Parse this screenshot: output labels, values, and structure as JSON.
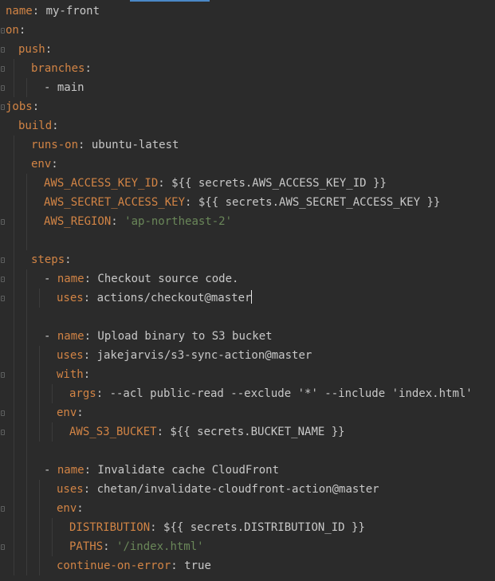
{
  "editor": {
    "lines": [
      {
        "parts": [
          {
            "t": "name",
            "c": "k"
          },
          {
            "t": ": my-front",
            "c": "p"
          }
        ]
      },
      {
        "parts": [
          {
            "t": "on",
            "c": "k"
          },
          {
            "t": ":",
            "c": "p"
          }
        ]
      },
      {
        "parts": [
          {
            "t": "push",
            "c": "k"
          },
          {
            "t": ":",
            "c": "p"
          }
        ]
      },
      {
        "parts": [
          {
            "t": "branches",
            "c": "k"
          },
          {
            "t": ":",
            "c": "p"
          }
        ]
      },
      {
        "parts": [
          {
            "t": "- main",
            "c": "p"
          }
        ]
      },
      {
        "parts": [
          {
            "t": "jobs",
            "c": "k"
          },
          {
            "t": ":",
            "c": "p"
          }
        ]
      },
      {
        "parts": [
          {
            "t": "build",
            "c": "k"
          },
          {
            "t": ":",
            "c": "p"
          }
        ]
      },
      {
        "parts": [
          {
            "t": "runs-on",
            "c": "k"
          },
          {
            "t": ": ubuntu-latest",
            "c": "p"
          }
        ]
      },
      {
        "parts": [
          {
            "t": "env",
            "c": "k"
          },
          {
            "t": ":",
            "c": "p"
          }
        ]
      },
      {
        "parts": [
          {
            "t": "AWS_ACCESS_KEY_ID",
            "c": "k"
          },
          {
            "t": ": ${{ secrets.AWS_ACCESS_KEY_ID }}",
            "c": "p"
          }
        ]
      },
      {
        "parts": [
          {
            "t": "AWS_SECRET_ACCESS_KEY",
            "c": "k"
          },
          {
            "t": ": ${{ secrets.AWS_SECRET_ACCESS_KEY }}",
            "c": "p"
          }
        ]
      },
      {
        "parts": [
          {
            "t": "AWS_REGION",
            "c": "k"
          },
          {
            "t": ": ",
            "c": "p"
          },
          {
            "t": "'ap-northeast-2'",
            "c": "s"
          }
        ]
      },
      {
        "parts": []
      },
      {
        "parts": [
          {
            "t": "steps",
            "c": "k"
          },
          {
            "t": ":",
            "c": "p"
          }
        ]
      },
      {
        "parts": [
          {
            "t": "- ",
            "c": "p"
          },
          {
            "t": "name",
            "c": "k"
          },
          {
            "t": ": Checkout source code.",
            "c": "p"
          }
        ]
      },
      {
        "parts": [
          {
            "t": "uses",
            "c": "k"
          },
          {
            "t": ": actions/checkout@master",
            "c": "p"
          }
        ]
      },
      {
        "parts": []
      },
      {
        "parts": [
          {
            "t": "- ",
            "c": "p"
          },
          {
            "t": "name",
            "c": "k"
          },
          {
            "t": ": Upload binary to S3 bucket",
            "c": "p"
          }
        ]
      },
      {
        "parts": [
          {
            "t": "uses",
            "c": "k"
          },
          {
            "t": ": jakejarvis/s3-sync-action@master",
            "c": "p"
          }
        ]
      },
      {
        "parts": [
          {
            "t": "with",
            "c": "k"
          },
          {
            "t": ":",
            "c": "p"
          }
        ]
      },
      {
        "parts": [
          {
            "t": "args",
            "c": "k"
          },
          {
            "t": ": --acl public-read --exclude '*' --include 'index.html'",
            "c": "p"
          }
        ]
      },
      {
        "parts": [
          {
            "t": "env",
            "c": "k"
          },
          {
            "t": ":",
            "c": "p"
          }
        ]
      },
      {
        "parts": [
          {
            "t": "AWS_S3_BUCKET",
            "c": "k"
          },
          {
            "t": ": ${{ secrets.BUCKET_NAME }}",
            "c": "p"
          }
        ]
      },
      {
        "parts": []
      },
      {
        "parts": [
          {
            "t": "- ",
            "c": "p"
          },
          {
            "t": "name",
            "c": "k"
          },
          {
            "t": ": Invalidate cache CloudFront",
            "c": "p"
          }
        ]
      },
      {
        "parts": [
          {
            "t": "uses",
            "c": "k"
          },
          {
            "t": ": chetan/invalidate-cloudfront-action@master",
            "c": "p"
          }
        ]
      },
      {
        "parts": [
          {
            "t": "env",
            "c": "k"
          },
          {
            "t": ":",
            "c": "p"
          }
        ]
      },
      {
        "parts": [
          {
            "t": "DISTRIBUTION",
            "c": "k"
          },
          {
            "t": ": ${{ secrets.DISTRIBUTION_ID }}",
            "c": "p"
          }
        ]
      },
      {
        "parts": [
          {
            "t": "PATHS",
            "c": "k"
          },
          {
            "t": ": ",
            "c": "p"
          },
          {
            "t": "'/index.html'",
            "c": "s"
          }
        ]
      },
      {
        "parts": [
          {
            "t": "continue-on-error",
            "c": "k"
          },
          {
            "t": ": true",
            "c": "p"
          }
        ]
      }
    ]
  },
  "colors": {
    "background": "#2b2b2b",
    "key": "#d28445",
    "plain": "#c8c8c8",
    "string": "#6a8759",
    "tab_indicator": "#4a88c7"
  }
}
